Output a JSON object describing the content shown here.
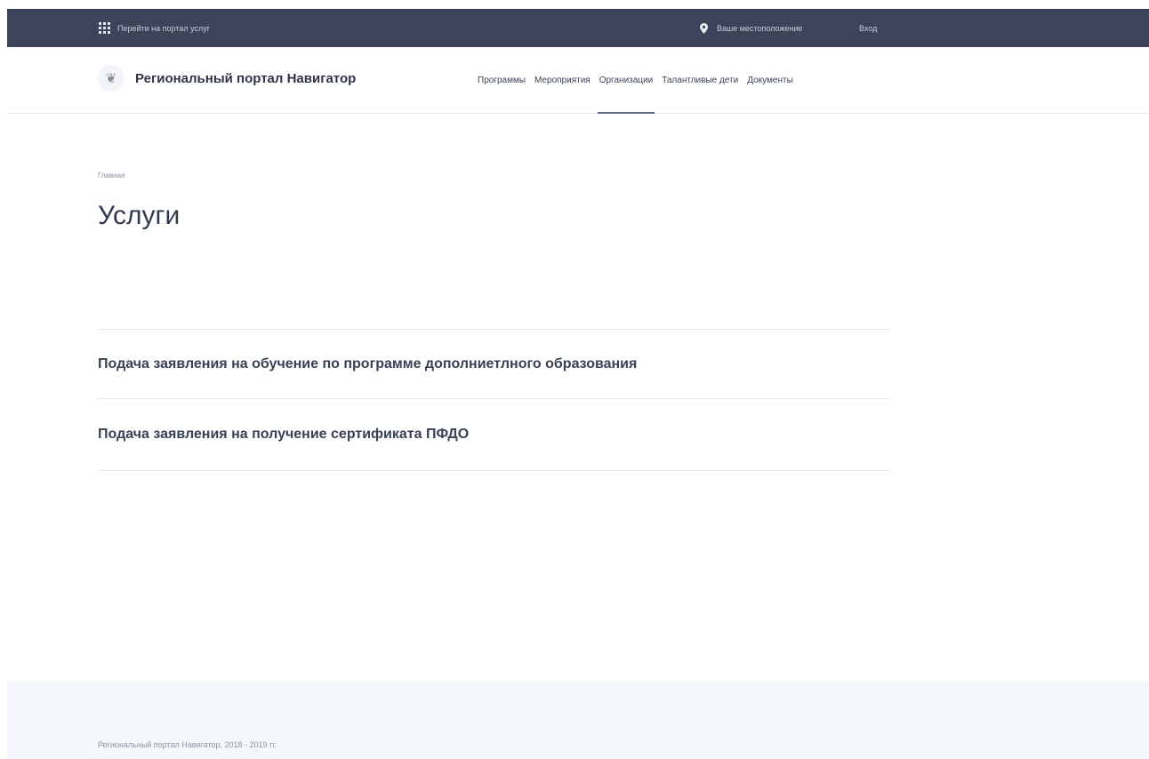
{
  "topbar": {
    "portal_link": "Перейти на портал услуг",
    "location": "Ваше местоположение",
    "login": "Вход"
  },
  "header": {
    "site_title": "Региональный портал Навигатор",
    "nav": [
      {
        "label": "Программы",
        "active": false
      },
      {
        "label": "Мероприятия",
        "active": false
      },
      {
        "label": "Организации",
        "active": true
      },
      {
        "label": "Талантливые дети",
        "active": false
      },
      {
        "label": "Документы",
        "active": false
      }
    ]
  },
  "main": {
    "breadcrumb": "Главная",
    "title": "Услуги",
    "services": [
      "Подача заявления на обучение по программе дополниетлного образования",
      "Подача заявления на получение сертификата ПФДО"
    ]
  },
  "footer": {
    "copyright": "Региональный портал Навигатор, 2018 - 2019 гг."
  },
  "colors": {
    "topbar_bg": "#3d4459",
    "footer_bg": "#f4f7fb",
    "active_underline": "#5b6d8f"
  }
}
